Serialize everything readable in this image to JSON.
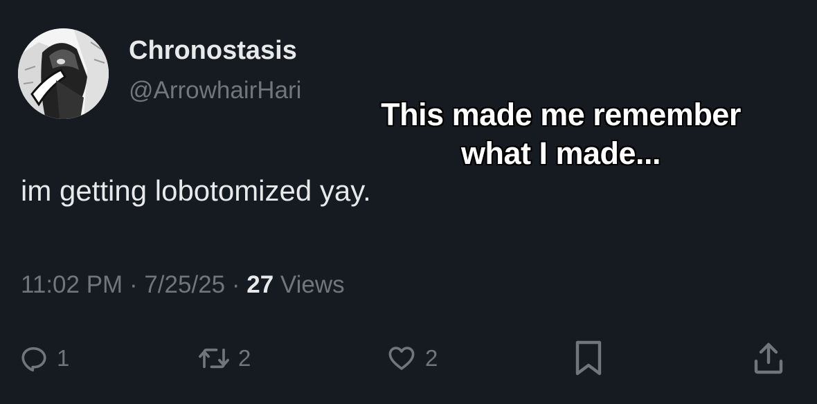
{
  "author": {
    "display_name": "Chronostasis",
    "handle": "@ArrowhairHari"
  },
  "overlay_caption": {
    "line1": "This made me remember",
    "line2": "what I made..."
  },
  "tweet": {
    "text": "im getting lobotomized yay.",
    "time": "11:02 PM",
    "separator": "·",
    "date": "7/25/25",
    "views_count": "27",
    "views_label": "Views"
  },
  "actions": {
    "reply_count": "1",
    "retweet_count": "2",
    "like_count": "2"
  },
  "icons": {
    "reply": "reply-icon",
    "retweet": "retweet-icon",
    "like": "heart-icon",
    "bookmark": "bookmark-icon",
    "share": "share-icon"
  },
  "colors": {
    "background": "#161b22",
    "primary_text": "#e7e9ea",
    "secondary_text": "#71767b"
  }
}
